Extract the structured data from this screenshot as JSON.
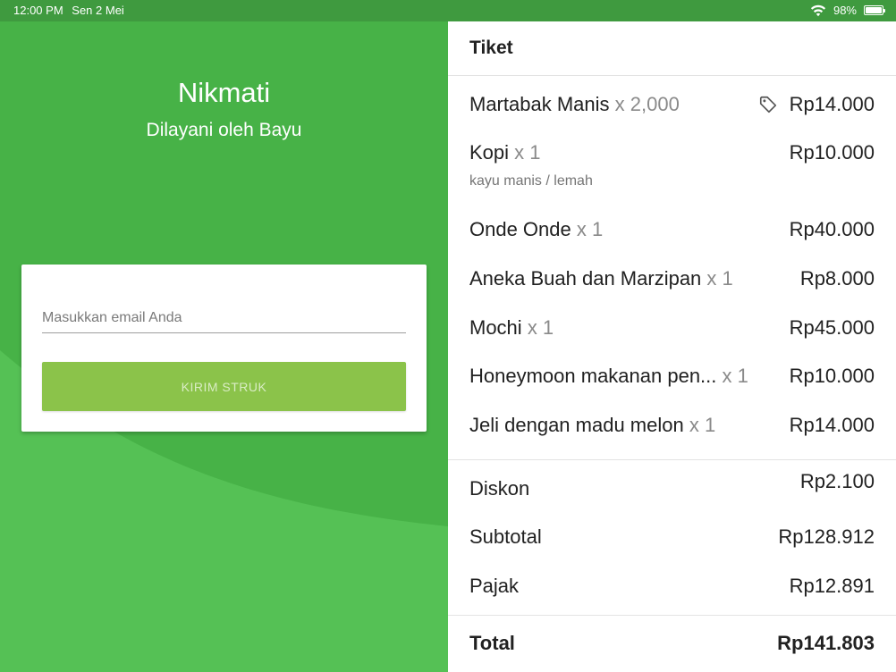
{
  "status_bar": {
    "time": "12:00 PM",
    "date": "Sen 2 Mei",
    "battery_text": "98%",
    "battery_level": 0.98
  },
  "customer": {
    "store_name": "Nikmati",
    "served_by": "Dilayani oleh Bayu",
    "email_placeholder": "Masukkan email Anda",
    "email_value": "",
    "send_button_label": "KIRIM STRUK"
  },
  "ticket": {
    "title": "Tiket",
    "items": [
      {
        "name": "Martabak Manis",
        "qty": "x 2,000",
        "price": "Rp14.000",
        "discount_tag": true,
        "note": ""
      },
      {
        "name": "Kopi",
        "qty": "x 1",
        "price": "Rp10.000",
        "discount_tag": false,
        "note": "kayu manis / lemah"
      },
      {
        "name": "Onde Onde",
        "qty": "x 1",
        "price": "Rp40.000",
        "discount_tag": false,
        "note": ""
      },
      {
        "name": "Aneka Buah dan Marzipan",
        "qty": "x 1",
        "price": "Rp8.000",
        "discount_tag": false,
        "note": ""
      },
      {
        "name": "Mochi",
        "qty": "x 1",
        "price": "Rp45.000",
        "discount_tag": false,
        "note": ""
      },
      {
        "name": "Honeymoon makanan pen...",
        "qty": "x 1",
        "price": "Rp10.000",
        "discount_tag": false,
        "note": ""
      },
      {
        "name": "Jeli dengan madu melon",
        "qty": "x 1",
        "price": "Rp14.000",
        "discount_tag": false,
        "note": ""
      }
    ],
    "summary": {
      "discount_label": "Diskon",
      "discount_value": "Rp2.100",
      "subtotal_label": "Subtotal",
      "subtotal_value": "Rp128.912",
      "tax_label": "Pajak",
      "tax_value": "Rp12.891",
      "total_label": "Total",
      "total_value": "Rp141.803"
    }
  },
  "colors": {
    "status_bar": "#3f9a3f",
    "panel_green": "#47b247",
    "wave_green": "#55c155",
    "button_green": "#8bc34a"
  },
  "icons": [
    "wifi-icon",
    "battery-icon",
    "tag-icon"
  ]
}
